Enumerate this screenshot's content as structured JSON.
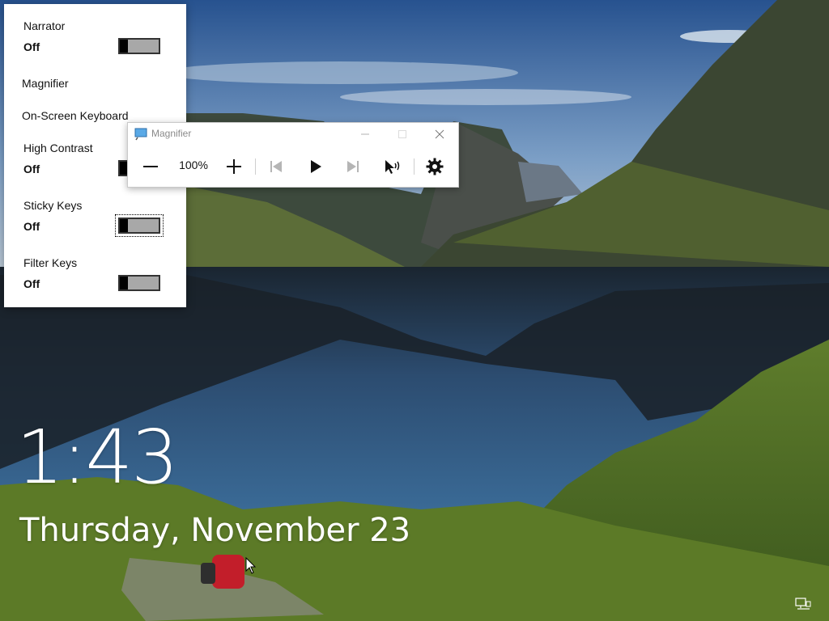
{
  "ease_of_access": {
    "narrator": {
      "label": "Narrator",
      "state": "Off"
    },
    "magnifier": {
      "label": "Magnifier"
    },
    "on_screen_keyboard": {
      "label": "On-Screen Keyboard"
    },
    "high_contrast": {
      "label": "High Contrast",
      "state": "Off"
    },
    "sticky_keys": {
      "label": "Sticky Keys",
      "state": "Off"
    },
    "filter_keys": {
      "label": "Filter Keys",
      "state": "Off"
    }
  },
  "magnifier_window": {
    "title": "Magnifier",
    "zoom_level": "100%",
    "icons": [
      "zoom-out-icon",
      "zoom-in-icon",
      "previous-icon",
      "play-icon",
      "next-icon",
      "read-from-here-icon",
      "settings-icon"
    ]
  },
  "lock_screen": {
    "time": "1:43",
    "date": "Thursday, November 23"
  },
  "colors": {
    "panel_bg": "#ffffff",
    "toggle_track": "#a8a8a8",
    "toggle_knob": "#000000",
    "text": "#111111",
    "disabled": "#b0b0b0"
  }
}
